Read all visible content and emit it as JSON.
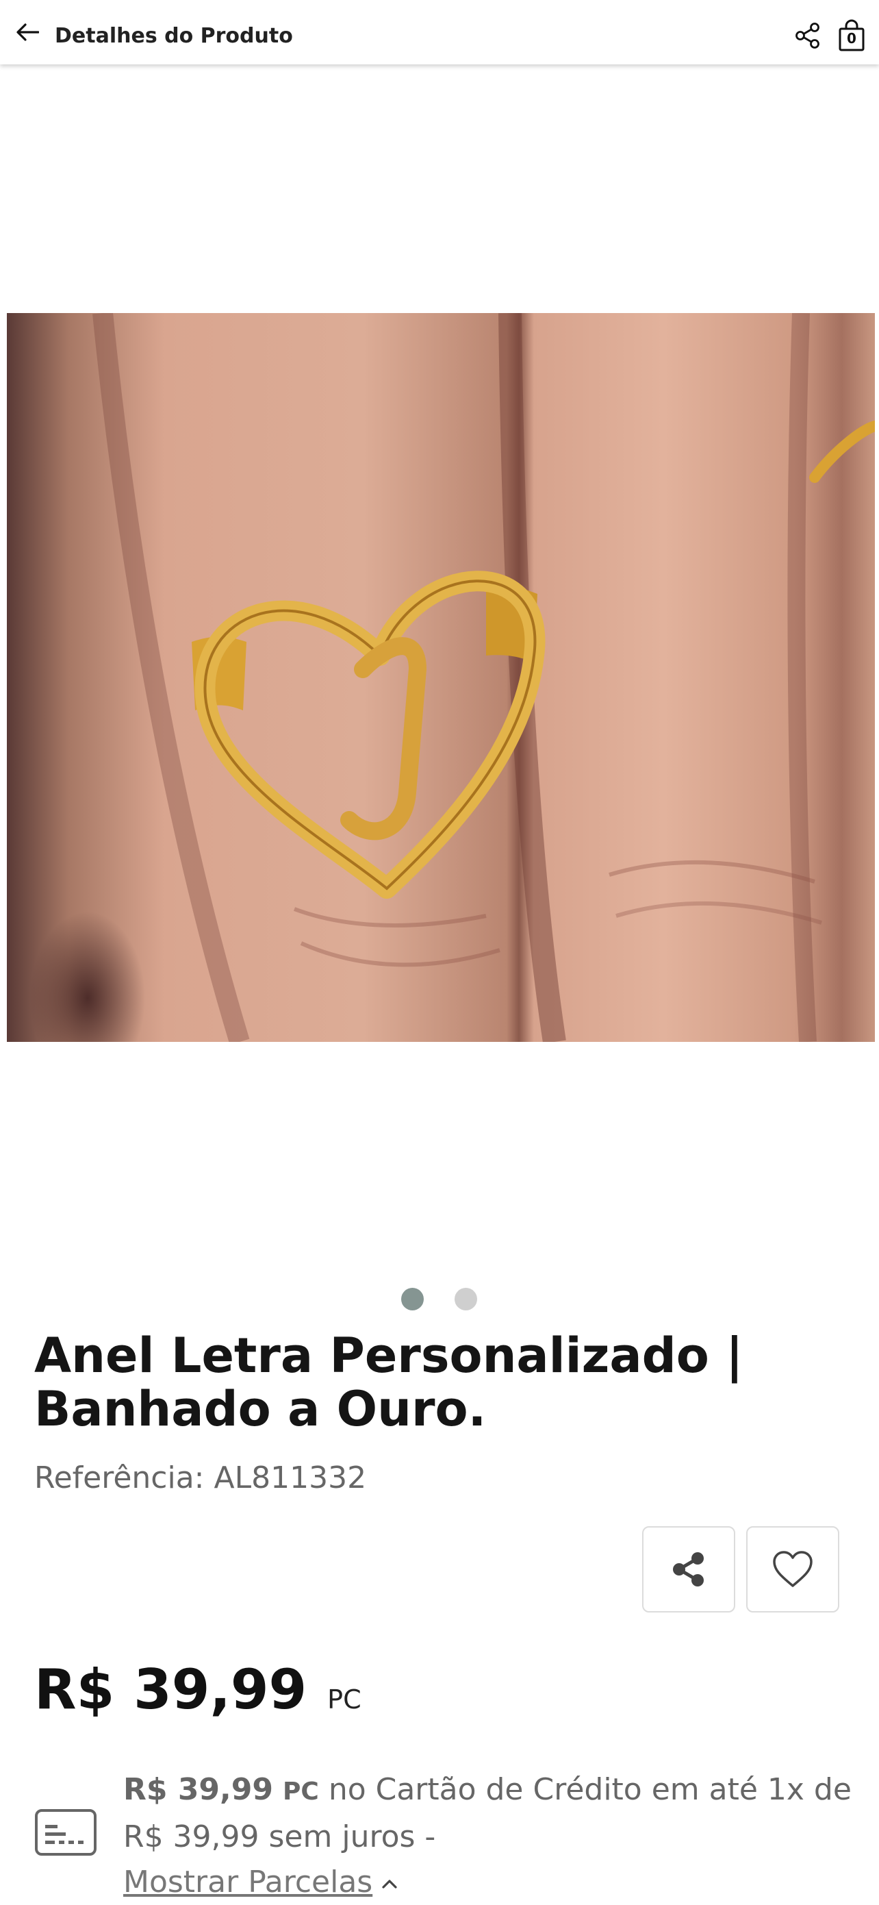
{
  "header": {
    "title": "Detalhes do Produto",
    "cart_count": "0"
  },
  "gallery": {
    "image_count": 2,
    "active_index": 0
  },
  "product": {
    "name": "Anel Letra Personalizado | Banhado a Ouro.",
    "reference_label": "Referência:",
    "reference_value": "AL811332",
    "price": "R$ 39,99",
    "price_unit": "PC"
  },
  "installments": {
    "price": "R$ 39,99",
    "unit": "PC",
    "text_after_unit": "no Cartão de Crédito em até 1x de R$ 39,99 sem juros -",
    "link_label": "Mostrar Parcelas"
  },
  "icons": {
    "back": "arrow-left-icon",
    "share": "share-icon",
    "cart": "shopping-bag-icon",
    "favorite": "heart-icon",
    "card": "credit-card-icon",
    "chevron": "chevron-up-icon"
  },
  "colors": {
    "dot_active": "#859592",
    "dot_inactive": "#cfcfcf"
  }
}
